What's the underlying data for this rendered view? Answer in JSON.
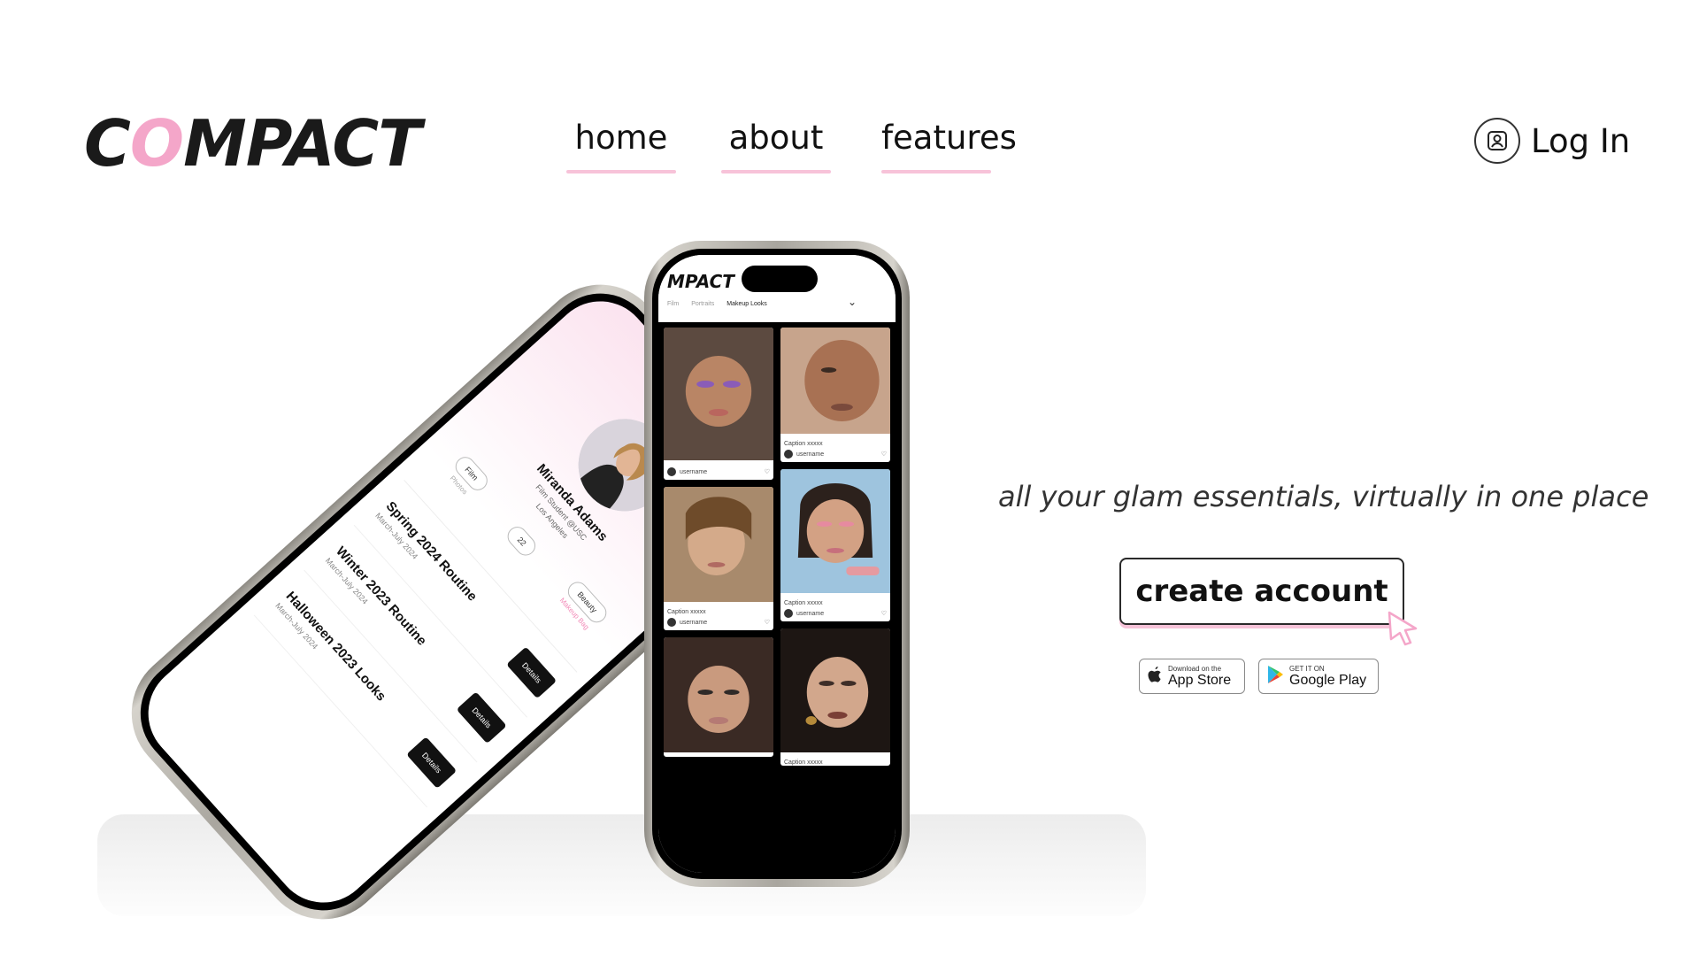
{
  "brand": {
    "logo_prefix": "C",
    "logo_o": "O",
    "logo_suffix": "MPACT",
    "accent_color": "#f4a6c9"
  },
  "nav": {
    "items": [
      {
        "label": "home"
      },
      {
        "label": "about"
      },
      {
        "label": "features"
      }
    ]
  },
  "login": {
    "label": "Log In",
    "icon": "user-badge-icon"
  },
  "hero": {
    "tagline": "all your glam essentials, virtually in one place",
    "cta_label": "create account",
    "cursor_icon": "pointer-cursor-icon"
  },
  "stores": {
    "apple": {
      "small": "Download on the",
      "big": "App Store",
      "icon": "apple-icon"
    },
    "google": {
      "small": "GET IT ON",
      "big": "Google Play",
      "icon": "google-play-icon"
    }
  },
  "feed_phone": {
    "logo": "MPACT",
    "tabs": [
      "Film",
      "Portraits",
      "Makeup Looks"
    ],
    "captions": [
      "Caption xxxxx",
      "Caption xxxxx",
      "Caption xxxxx",
      "Caption xxxxx"
    ],
    "username": "username"
  },
  "profile_phone": {
    "name": "Miranda Adams",
    "subtitle": "Film Student @USC",
    "location": "Los Angeles",
    "pills": [
      {
        "label": "Film",
        "caption": "Photos"
      },
      {
        "label": "22",
        "caption": ""
      },
      {
        "label": "Beauty",
        "caption": "Makeup Bag"
      }
    ],
    "routines": [
      {
        "title": "Spring 2024 Routine",
        "date": "March-July 2024",
        "button": "Details"
      },
      {
        "title": "Winter 2023 Routine",
        "date": "March-July 2024",
        "button": "Details"
      },
      {
        "title": "Halloween 2023 Looks",
        "date": "March-July 2024",
        "button": "Details"
      }
    ]
  }
}
